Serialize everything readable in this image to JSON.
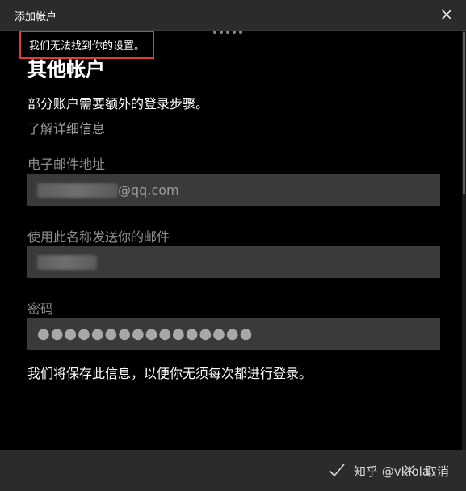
{
  "window": {
    "title": "添加帐户"
  },
  "error": {
    "message": "我们无法找到你的设置。"
  },
  "main": {
    "heading": "其他帐户",
    "subtext": "部分账户需要额外的登录步骤。",
    "learn_more": "了解详细信息"
  },
  "email": {
    "label": "电子邮件地址",
    "visible_suffix": "@qq.com"
  },
  "sender_name": {
    "label": "使用此名称发送你的邮件"
  },
  "password": {
    "label": "密码",
    "masked_value": "●●●●●●●●●●●●●●●●"
  },
  "save_note": "我们将保存此信息，以便你无须每次都进行登录。",
  "footer": {
    "watermark": "知乎 @vkiola",
    "cancel_label": "取消"
  },
  "colors": {
    "error_border": "#e03a3a",
    "field_bg": "#3a3a3a",
    "bar_bg": "#2b2b2b"
  }
}
